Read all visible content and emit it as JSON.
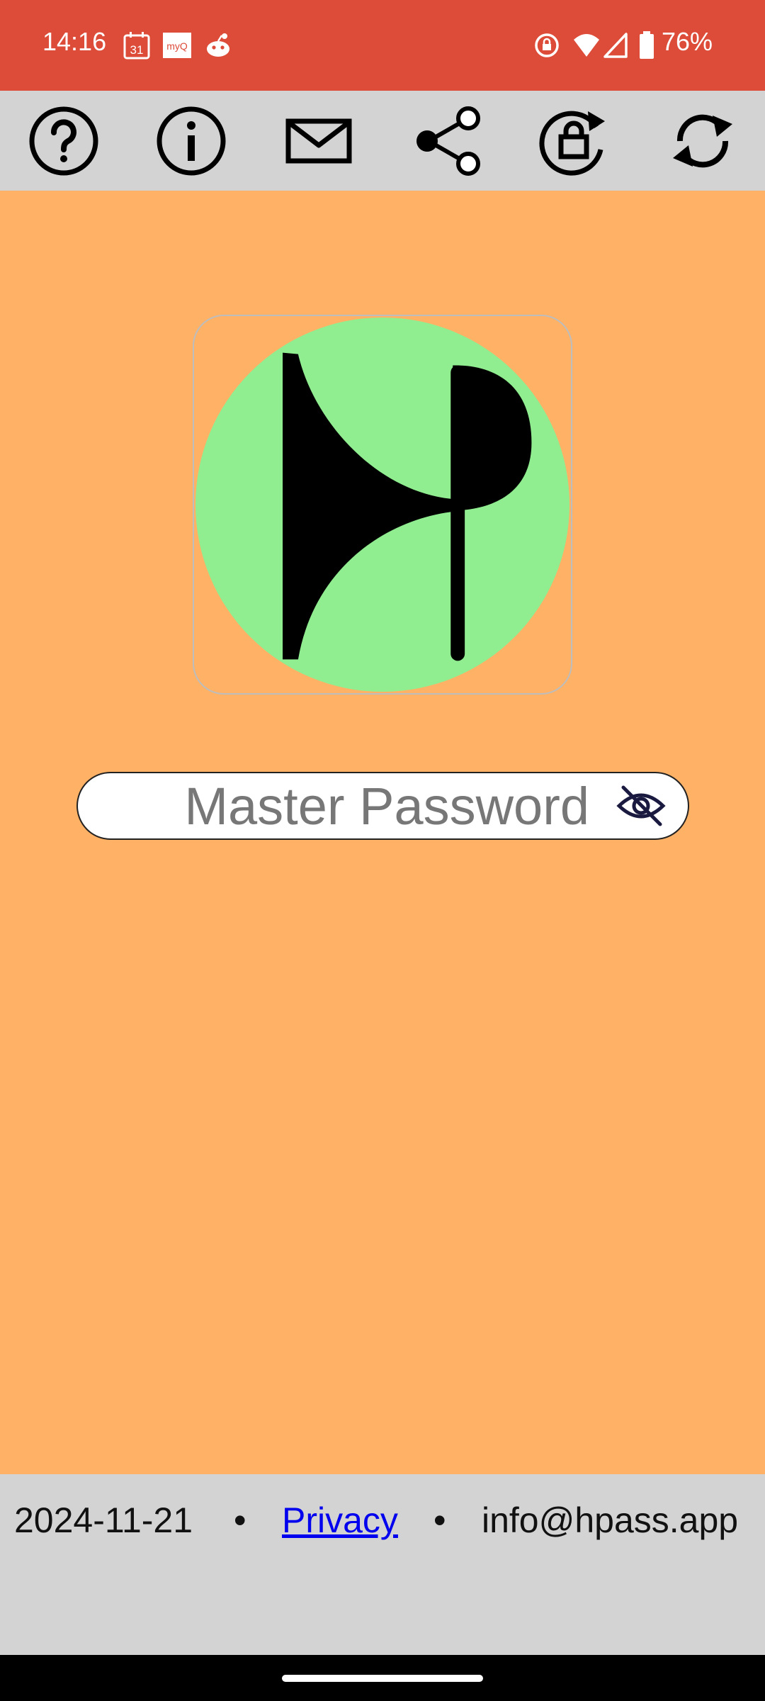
{
  "status_bar": {
    "time": "14:16",
    "calendar_day": "31",
    "myq_label": "myQ",
    "battery_percent": "76%",
    "bar_color": "#DD4B39",
    "icons": [
      "calendar-icon",
      "myq-icon",
      "reddit-icon",
      "rotate-lock-icon",
      "wifi-icon",
      "cell-signal-icon",
      "battery-icon"
    ]
  },
  "toolbar": {
    "background": "#D3D3D3",
    "buttons": [
      {
        "icon": "help-icon"
      },
      {
        "icon": "info-icon"
      },
      {
        "icon": "mail-icon"
      },
      {
        "icon": "share-icon"
      },
      {
        "icon": "lock-rotate-icon"
      },
      {
        "icon": "refresh-icon"
      }
    ]
  },
  "logo": {
    "circle_color": "#90EE90",
    "glyph_color": "#000000"
  },
  "password": {
    "placeholder": "Master Password",
    "value": ""
  },
  "footer": {
    "date": "2024-11-21",
    "separator": "•",
    "privacy_label": "Privacy",
    "email": "info@hpass.app"
  },
  "colors": {
    "background": "#FFB165",
    "link": "#0000EE"
  }
}
